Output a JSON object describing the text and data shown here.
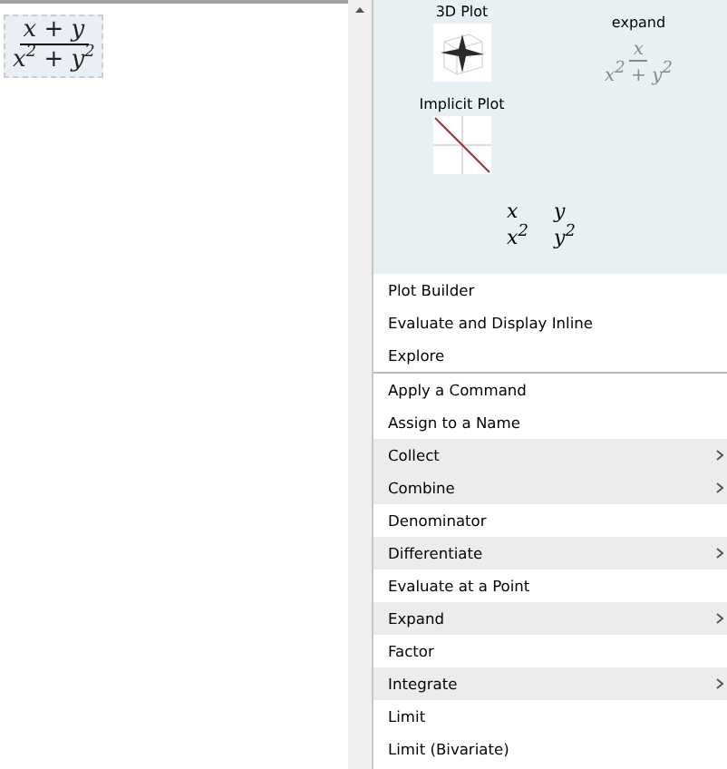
{
  "document": {
    "expression": {
      "numerator": "x + y",
      "denominator": "x$^{2}$ + y$^{2}$"
    }
  },
  "previews": {
    "plot3d": {
      "label": "3D Plot"
    },
    "expand": {
      "label": "expand",
      "numerator": "x",
      "denominator": "x$^{2}$ + y$^{2}$"
    },
    "implicit": {
      "label": "Implicit Plot"
    },
    "terms": [
      "x",
      "y",
      "x$^{2}$",
      "y$^{2}$"
    ]
  },
  "menu": {
    "groups": [
      [
        {
          "label": "Plot Builder",
          "submenu": false
        },
        {
          "label": "Evaluate and Display Inline",
          "submenu": false
        },
        {
          "label": "Explore",
          "submenu": false
        }
      ],
      [
        {
          "label": "Apply a Command",
          "submenu": false
        },
        {
          "label": "Assign to a Name",
          "submenu": false
        },
        {
          "label": "Collect",
          "submenu": true
        },
        {
          "label": "Combine",
          "submenu": true
        },
        {
          "label": "Denominator",
          "submenu": false
        },
        {
          "label": "Differentiate",
          "submenu": true
        },
        {
          "label": "Evaluate at a Point",
          "submenu": false
        },
        {
          "label": "Expand",
          "submenu": true
        },
        {
          "label": "Factor",
          "submenu": false
        },
        {
          "label": "Integrate",
          "submenu": true
        },
        {
          "label": "Limit",
          "submenu": false
        },
        {
          "label": "Limit (Bivariate)",
          "submenu": false
        }
      ]
    ]
  }
}
